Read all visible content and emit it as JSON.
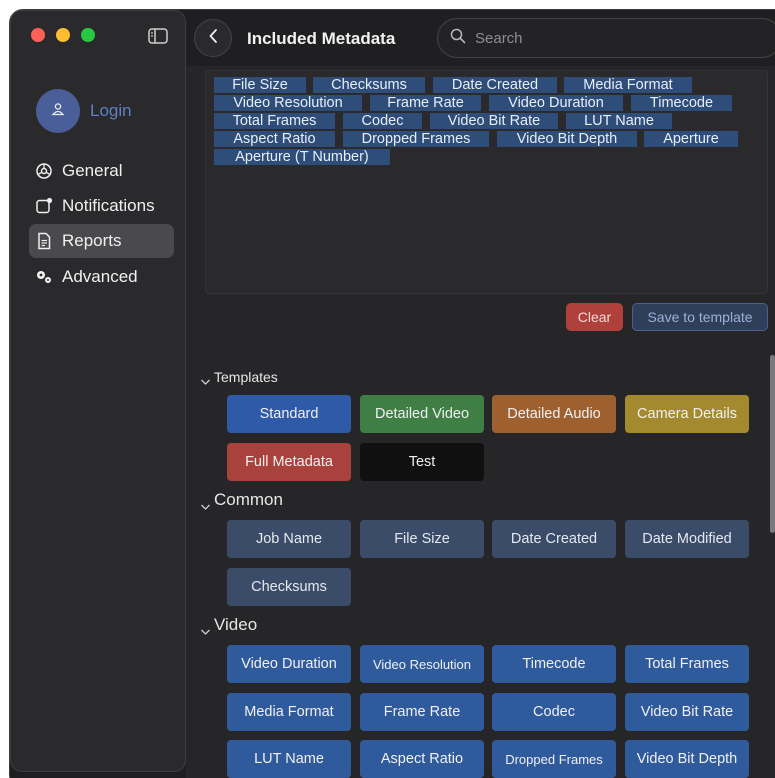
{
  "window": {
    "title": "Included Metadata",
    "search_placeholder": "Search"
  },
  "sidebar": {
    "login_label": "Login",
    "items": [
      {
        "label": "General",
        "icon": "gear-icon",
        "active": false
      },
      {
        "label": "Notifications",
        "icon": "notification-icon",
        "active": false
      },
      {
        "label": "Reports",
        "icon": "document-icon",
        "active": true
      },
      {
        "label": "Advanced",
        "icon": "gears-icon",
        "active": false
      }
    ]
  },
  "included_metadata": [
    "File Size",
    "Checksums",
    "Date Created",
    "Media Format",
    "Video Resolution",
    "Frame Rate",
    "Video Duration",
    "Timecode",
    "Total Frames",
    "Codec",
    "Video Bit Rate",
    "LUT Name",
    "Aspect Ratio",
    "Dropped Frames",
    "Video Bit Depth",
    "Aperture",
    "Aperture (T Number)"
  ],
  "actions": {
    "clear_label": "Clear",
    "save_label": "Save to template"
  },
  "sections": {
    "templates": {
      "title": "Templates",
      "items": [
        "Standard",
        "Detailed Video",
        "Detailed Audio",
        "Camera Details",
        "Full Metadata",
        "Test"
      ]
    },
    "common": {
      "title": "Common",
      "items": [
        "Job Name",
        "File Size",
        "Date Created",
        "Date Modified",
        "Checksums"
      ]
    },
    "video": {
      "title": "Video",
      "items": [
        "Video Duration",
        "Video Resolution",
        "Timecode",
        "Total Frames",
        "Media Format",
        "Frame Rate",
        "Codec",
        "Video Bit Rate",
        "LUT Name",
        "Aspect Ratio",
        "Dropped Frames",
        "Video Bit Depth"
      ]
    }
  },
  "colors": {
    "accent": "#2e5aa8",
    "chip": "#2e4d79",
    "clear": "#b0403b",
    "template_green": "#3f7f46",
    "template_orange": "#9f6030",
    "template_gold": "#a48a2e",
    "template_red": "#a9423c"
  }
}
